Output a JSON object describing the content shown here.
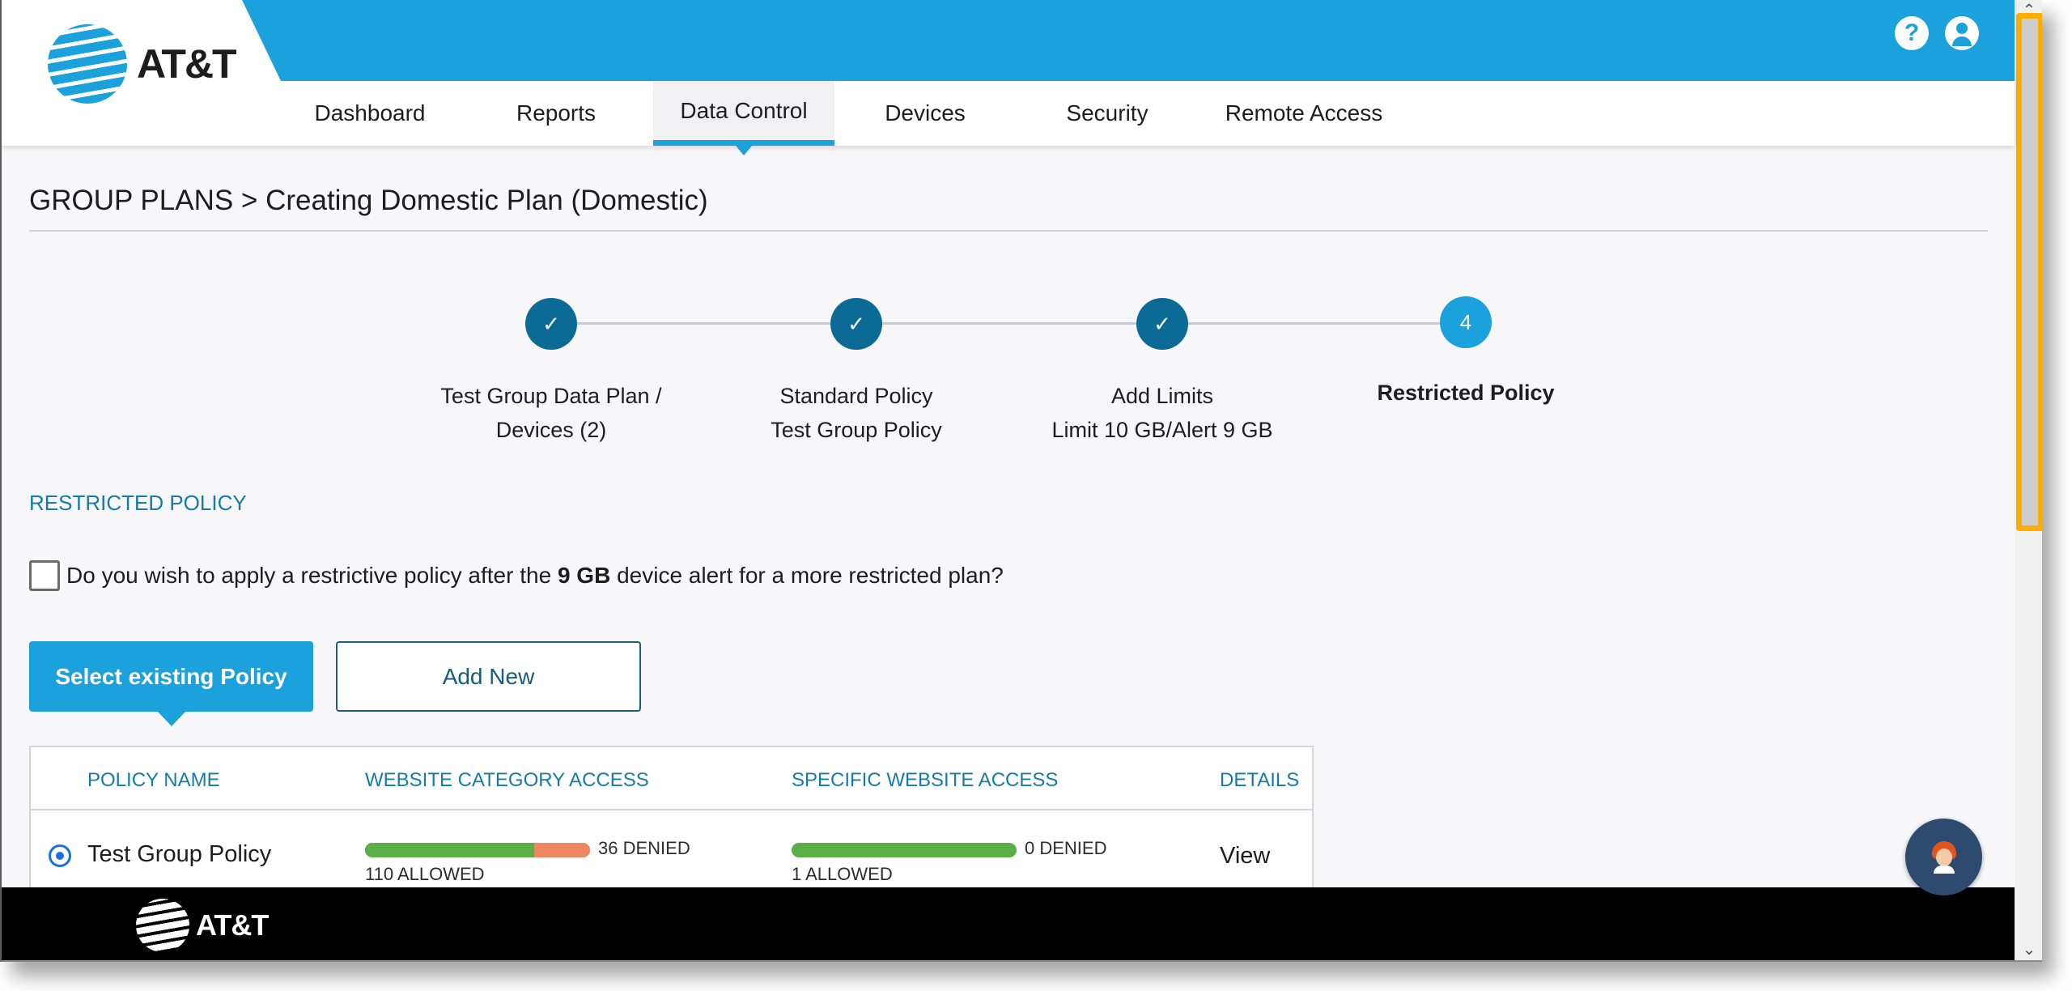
{
  "brand": {
    "name": "AT&T",
    "accent": "#1ba1dc",
    "dark_accent": "#0c6b96"
  },
  "header": {
    "icons": [
      {
        "name": "help-icon",
        "glyph": "?"
      },
      {
        "name": "user-account-icon",
        "glyph": ""
      }
    ]
  },
  "nav": {
    "tabs": [
      {
        "label": "Dashboard",
        "active": false
      },
      {
        "label": "Reports",
        "active": false
      },
      {
        "label": "Data Control",
        "active": true
      },
      {
        "label": "Devices",
        "active": false
      },
      {
        "label": "Security",
        "active": false
      },
      {
        "label": "Remote Access",
        "active": false
      }
    ]
  },
  "breadcrumb": "GROUP PLANS > Creating Domestic Plan (Domestic)",
  "stepper": {
    "steps": [
      {
        "status": "done",
        "marker": "✓",
        "line1": "Test Group Data Plan /",
        "line2": "Devices (2)"
      },
      {
        "status": "done",
        "marker": "✓",
        "line1": "Standard Policy",
        "line2": "Test Group Policy"
      },
      {
        "status": "done",
        "marker": "✓",
        "line1": "Add Limits",
        "line2": "Limit 10 GB/Alert 9 GB"
      },
      {
        "status": "current",
        "marker": "4",
        "line1": "Restricted Policy",
        "line2": ""
      }
    ]
  },
  "restricted": {
    "section_title": "RESTRICTED POLICY",
    "question_prefix": "Do you wish to apply a restrictive policy after the ",
    "question_bold": "9 GB",
    "question_suffix": " device alert for a more restricted plan?",
    "checked": false,
    "select_existing_label": "Select existing Policy",
    "add_new_label": "Add New"
  },
  "policy_table": {
    "headers": {
      "name": "POLICY NAME",
      "category": "WEBSITE CATEGORY ACCESS",
      "specific": "SPECIFIC WEBSITE ACCESS",
      "details": "DETAILS"
    },
    "rows": [
      {
        "selected": true,
        "name": "Test Group Policy",
        "category": {
          "allowed": 110,
          "denied": 36,
          "allowed_label": "110 ALLOWED",
          "denied_label": "36 DENIED"
        },
        "specific": {
          "allowed": 1,
          "denied": 0,
          "allowed_label": "1 ALLOWED",
          "denied_label": "0 DENIED"
        },
        "details_label": "View"
      }
    ]
  },
  "footer": {
    "brand": "AT&T"
  },
  "chat": {
    "icon": "chat-assistant-avatar-icon"
  }
}
